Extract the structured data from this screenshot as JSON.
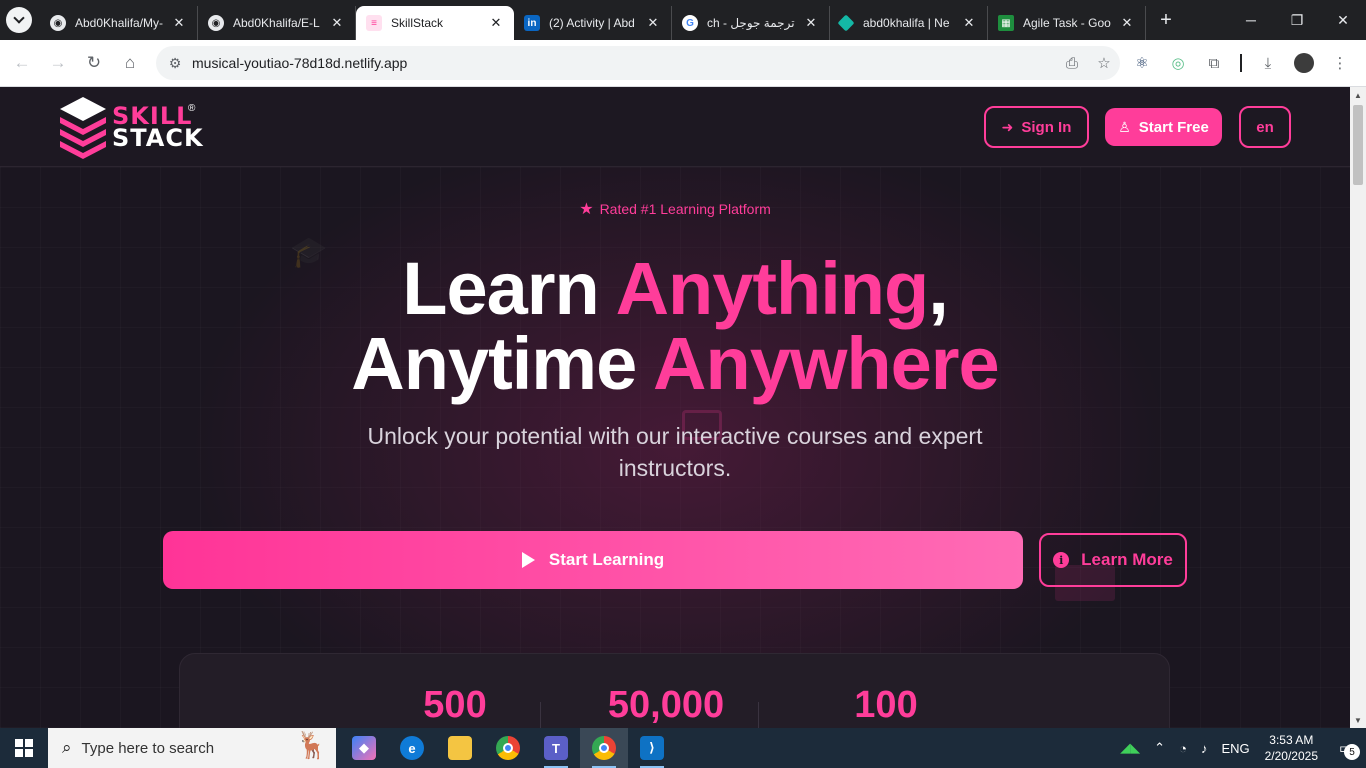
{
  "browser": {
    "tabs": [
      {
        "title": "Abd0Khalifa/My-",
        "icon": "github-icon",
        "active": false
      },
      {
        "title": "Abd0Khalifa/E-L",
        "icon": "github-icon",
        "active": false
      },
      {
        "title": "SkillStack",
        "icon": "skillstack-icon",
        "active": true
      },
      {
        "title": "(2) Activity | Abd",
        "icon": "linkedin-icon",
        "active": false
      },
      {
        "title": "ch - ترجمة جوجل",
        "icon": "google-icon",
        "active": false
      },
      {
        "title": "abd0khalifa | Ne",
        "icon": "netlify-icon",
        "active": false
      },
      {
        "title": "Agile Task - Goo",
        "icon": "sheets-icon",
        "active": false
      }
    ],
    "url": "musical-youtiao-78d18d.netlify.app"
  },
  "site": {
    "logo": {
      "line1": "SKILL",
      "line2": "STACK",
      "reg": "®"
    },
    "header": {
      "sign_in": "Sign In",
      "start_free": "Start Free",
      "lang": "en"
    },
    "badge": "Rated #1 Learning Platform",
    "hero": {
      "title_a": "Learn ",
      "title_b": "Anything",
      "title_c": ",",
      "title_d": "Anytime ",
      "title_e": "Anywhere",
      "subtitle_1": "Unlock your potential with our interactive courses and expert",
      "subtitle_2": "instructors."
    },
    "cta": {
      "primary": "Start Learning",
      "secondary": "Learn More"
    },
    "stats": [
      "500",
      "50,000",
      "100"
    ],
    "accent_color": "#ff3d9a"
  },
  "taskbar": {
    "search_placeholder": "Type here to search",
    "lang": "ENG",
    "time": "3:53 AM",
    "date": "2/20/2025",
    "notifications": "5"
  }
}
